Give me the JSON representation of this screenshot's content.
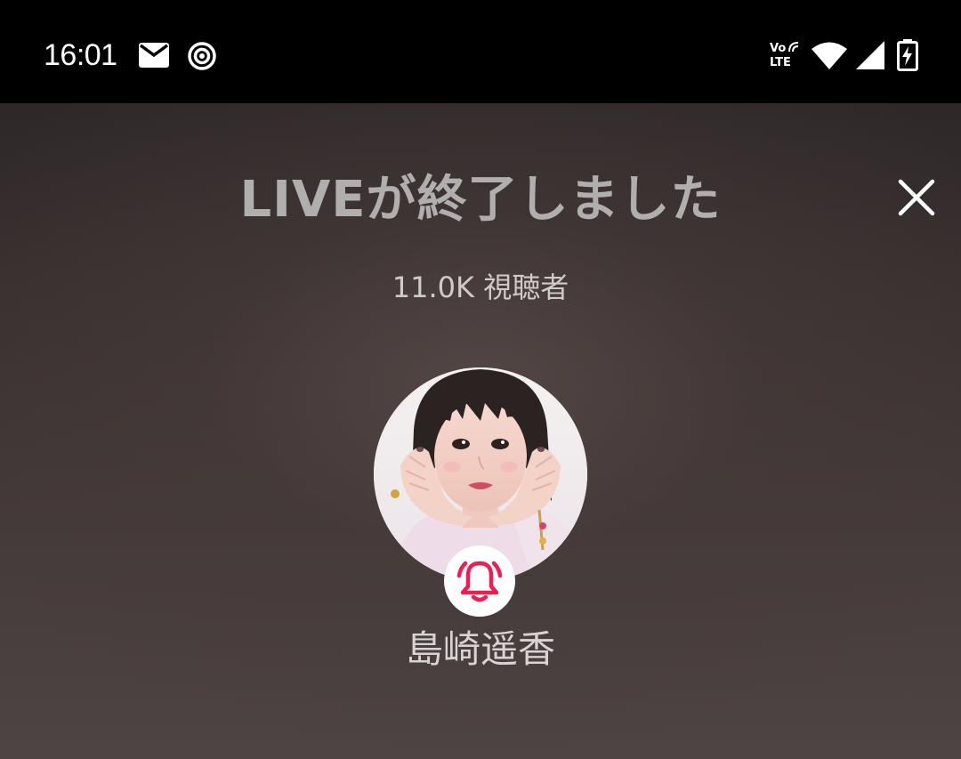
{
  "status_bar": {
    "time": "16:01",
    "icons": [
      "mail-icon",
      "hotspot-icon",
      "volte-icon",
      "wifi-icon",
      "signal-icon",
      "battery-charging-icon"
    ],
    "volte_top": "Vo",
    "volte_bottom": "LTE"
  },
  "live_end": {
    "title": "LIVEが終了しました",
    "viewers": "11.0K 視聴者",
    "host_name": "島崎遥香",
    "close_icon": "close-icon",
    "notify_icon": "bell-icon"
  },
  "colors": {
    "status_bar_bg": "#000000",
    "title_text": "#b1aeae",
    "bell_accent": "#ee1d52",
    "badge_bg": "#ffffff"
  }
}
